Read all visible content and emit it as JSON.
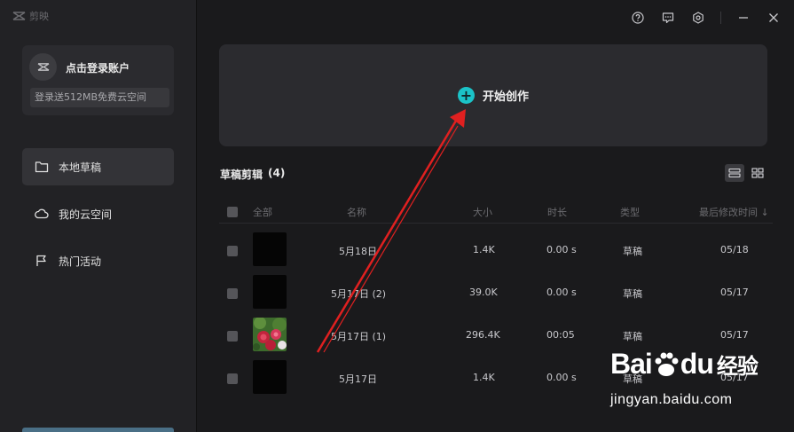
{
  "app": {
    "logo_text": "剪映"
  },
  "account": {
    "login_label": "点击登录账户",
    "promo_text": "登录送512MB免费云空间"
  },
  "sidebar": {
    "items": [
      {
        "label": "本地草稿",
        "icon": "folder-icon",
        "active": true
      },
      {
        "label": "我的云空间",
        "icon": "cloud-icon",
        "active": false
      },
      {
        "label": "热门活动",
        "icon": "flag-icon",
        "active": false
      }
    ]
  },
  "topbar": {
    "icons": [
      "help-icon",
      "feedback-icon",
      "settings-icon",
      "minimize-icon",
      "close-icon"
    ]
  },
  "create": {
    "label": "开始创作",
    "accent": "#1bc3c8"
  },
  "drafts": {
    "title": "草稿剪辑",
    "count": "(4)",
    "columns": {
      "all": "全部",
      "name": "名称",
      "size": "大小",
      "duration": "时长",
      "type": "类型",
      "modified": "最后修改时间 ↓"
    },
    "rows": [
      {
        "name": "5月18日",
        "size": "1.4K",
        "duration": "0.00 s",
        "type": "草稿",
        "modified": "05/18",
        "thumb": "black"
      },
      {
        "name": "5月17日 (2)",
        "size": "39.0K",
        "duration": "0.00 s",
        "type": "草稿",
        "modified": "05/17",
        "thumb": "black"
      },
      {
        "name": "5月17日 (1)",
        "size": "296.4K",
        "duration": "00:05",
        "type": "草稿",
        "modified": "05/17",
        "thumb": "flowers"
      },
      {
        "name": "5月17日",
        "size": "1.4K",
        "duration": "0.00 s",
        "type": "草稿",
        "modified": "05/17",
        "thumb": "black"
      }
    ]
  },
  "watermark": {
    "brand": "Bai",
    "brand_tail": "du",
    "cn": "经验",
    "url": "jingyan.baidu.com"
  },
  "annotation": {
    "arrow_color": "#e02020"
  }
}
